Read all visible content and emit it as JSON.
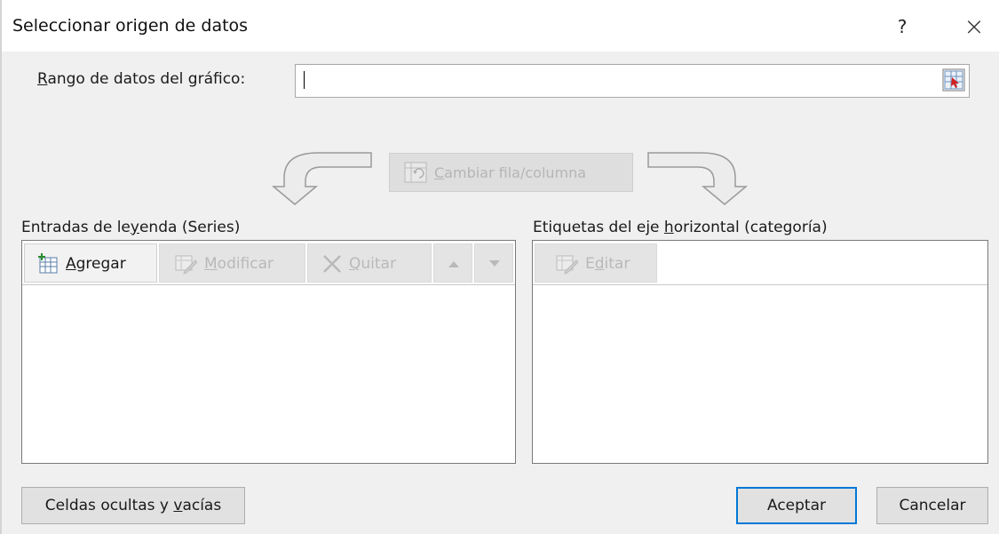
{
  "dialog": {
    "title": "Seleccionar origen de datos",
    "help": "?",
    "close": "×"
  },
  "range": {
    "label_before": "",
    "label_mnemonic": "R",
    "label_after": "ango de datos del gráfico:",
    "value": ""
  },
  "switch": {
    "label_mnemonic": "C",
    "label_after": "ambiar fila/columna"
  },
  "legend": {
    "label_before": "Entradas de le",
    "label_mnemonic": "y",
    "label_after": "enda (Series)",
    "add_mnemonic": "A",
    "add_after": "gregar",
    "edit_mnemonic": "M",
    "edit_after": "odificar",
    "remove_mnemonic": "Q",
    "remove_after": "uitar",
    "items": []
  },
  "axis": {
    "label_before": "Etiquetas del eje ",
    "label_mnemonic": "h",
    "label_after": "orizontal (categoría)",
    "edit_before": "E",
    "edit_mnemonic": "d",
    "edit_after": "itar",
    "items": []
  },
  "footer": {
    "hidden_before": "Celdas ocultas y ",
    "hidden_mnemonic": "v",
    "hidden_after": "acías",
    "ok": "Aceptar",
    "cancel": "Cancelar"
  },
  "colors": {
    "accent": "#0078d7",
    "disabled_text": "#b9b9b9"
  }
}
